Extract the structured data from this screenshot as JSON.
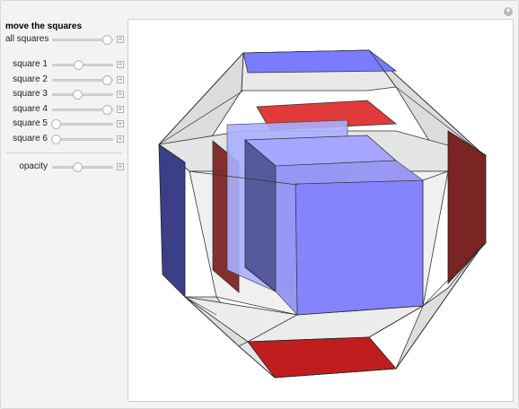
{
  "panel": {
    "title": "move the squares",
    "sliders": [
      {
        "label": "all squares",
        "value": 0.92
      },
      {
        "label": "square 1",
        "value": 0.44
      },
      {
        "label": "square 2",
        "value": 0.92
      },
      {
        "label": "square 3",
        "value": 0.42
      },
      {
        "label": "square 4",
        "value": 0.92
      },
      {
        "label": "square 5",
        "value": 0.06
      },
      {
        "label": "square 6",
        "value": 0.06
      }
    ],
    "opacity": {
      "label": "opacity",
      "value": 0.42
    }
  },
  "colors": {
    "blue_face": "#8080ff",
    "red_face": "#cc2222",
    "dark_red": "#7a2020",
    "dark_blue": "#3a3f86",
    "frame_line": "#333333"
  }
}
